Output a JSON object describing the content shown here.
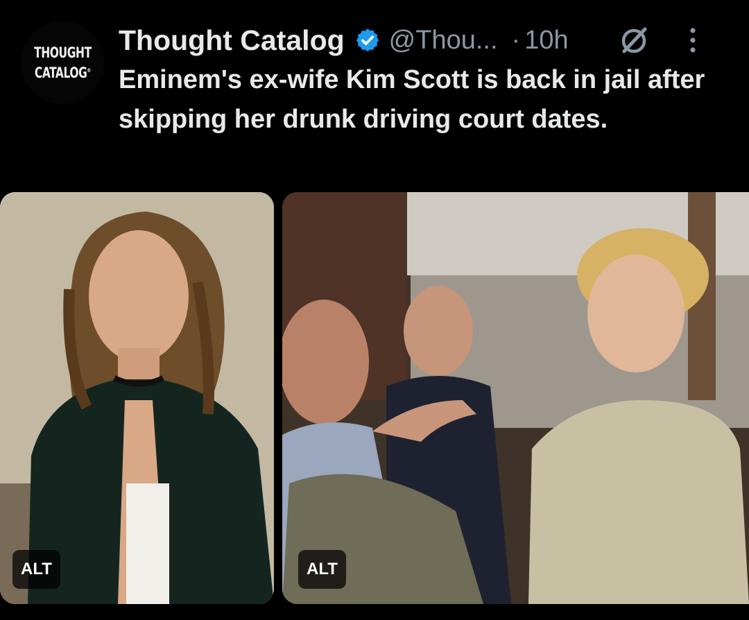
{
  "account": {
    "avatar_line1": "THOUGHT",
    "avatar_line2": "CATALOG",
    "name": "Thought Catalog",
    "verified": true,
    "handle": "@Thou...",
    "separator": "·",
    "time": "10h"
  },
  "icons": [
    "grok-icon",
    "more-options-icon",
    "verified-badge-icon"
  ],
  "tweet": {
    "text": "Eminem's ex-wife Kim Scott is back in jail after skipping her drunk driving court dates."
  },
  "media": [
    {
      "alt_label": "ALT"
    },
    {
      "alt_label": "ALT"
    }
  ],
  "colors": {
    "background": "#000000",
    "text": "#e7e9ea",
    "secondary": "#8b98a5",
    "verified": "#1d9bf0"
  }
}
